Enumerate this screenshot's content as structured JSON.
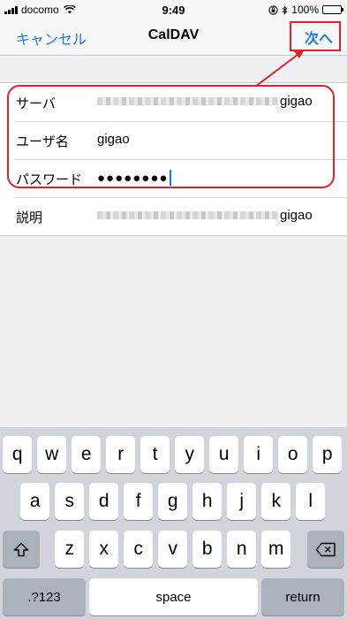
{
  "status": {
    "carrier": "docomo",
    "time": "9:49",
    "battery": "100%",
    "battery_level": 1.0
  },
  "nav": {
    "cancel_label": "キャンセル",
    "title": "CalDAV",
    "next_label": "次へ"
  },
  "form": {
    "server": {
      "label": "サーバ",
      "value": "gigao"
    },
    "username": {
      "label": "ユーザ名",
      "value": "gigao"
    },
    "password": {
      "label": "パスワード",
      "value": "●●●●●●●●"
    },
    "description": {
      "label": "説明",
      "value": "gigao"
    }
  },
  "keyboard": {
    "row1": [
      "q",
      "w",
      "e",
      "r",
      "t",
      "y",
      "u",
      "i",
      "o",
      "p"
    ],
    "row2": [
      "a",
      "s",
      "d",
      "f",
      "g",
      "h",
      "j",
      "k",
      "l"
    ],
    "row3": [
      "z",
      "x",
      "c",
      "v",
      "b",
      "n",
      "m"
    ],
    "shift_icon": "shift-icon",
    "delete_icon": "delete-icon",
    "numbers_label": ".?123",
    "space_label": "space",
    "return_label": "return"
  },
  "colors": {
    "accent": "#1f78e8",
    "annotation": "#e0202a"
  }
}
